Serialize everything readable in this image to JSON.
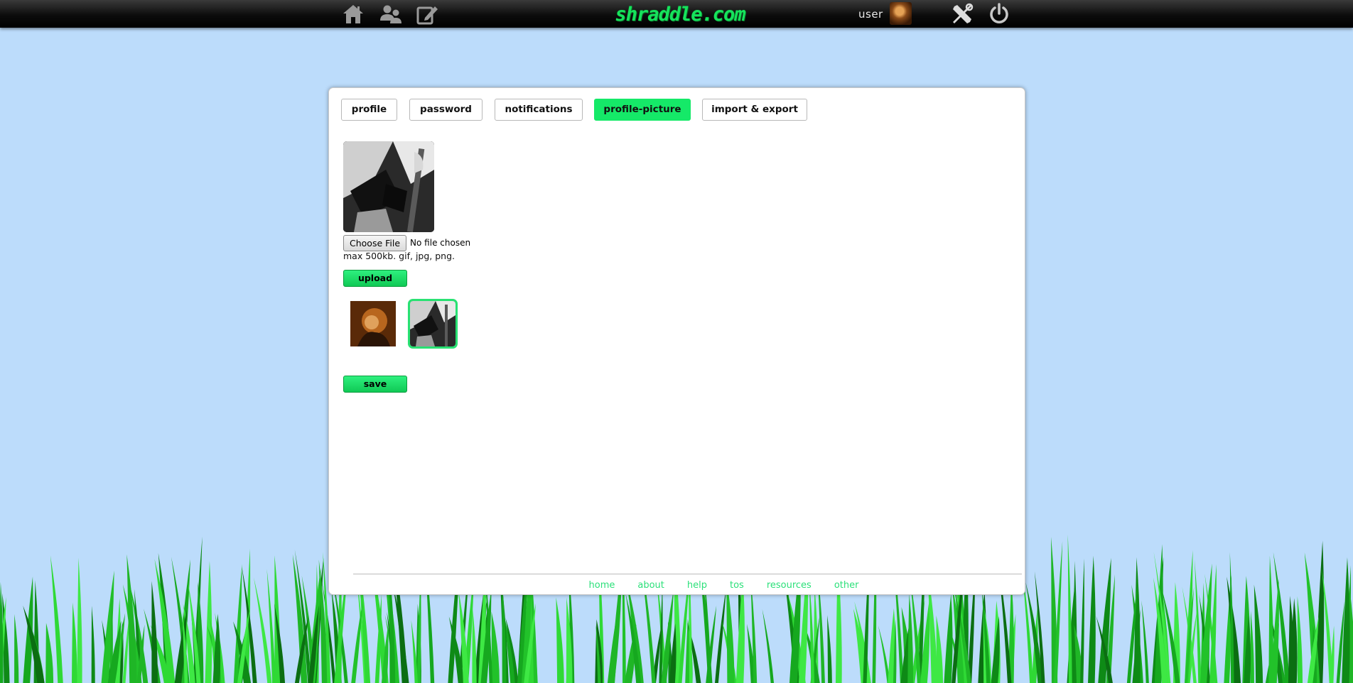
{
  "header": {
    "logo_text": "shraddle.com",
    "username": "user",
    "icons": [
      "home-icon",
      "friends-icon",
      "compose-icon",
      "settings-icon",
      "logout-icon"
    ]
  },
  "tabs": [
    {
      "label": "profile",
      "active": false
    },
    {
      "label": "password",
      "active": false
    },
    {
      "label": "notifications",
      "active": false
    },
    {
      "label": "profile-picture",
      "active": true
    },
    {
      "label": "import & export",
      "active": false
    }
  ],
  "upload": {
    "choose_file_label": "Choose File",
    "file_status": "No file chosen",
    "hint": "max 500kb. gif, jpg, png.",
    "upload_label": "upload"
  },
  "gallery": {
    "selected_index": 1
  },
  "save_label": "save",
  "footer": {
    "links": [
      "home",
      "about",
      "help",
      "tos",
      "resources",
      "other"
    ]
  },
  "colors": {
    "accent": "#15e968",
    "background": "#bcdcfb",
    "footer_link": "#2ce07a"
  }
}
